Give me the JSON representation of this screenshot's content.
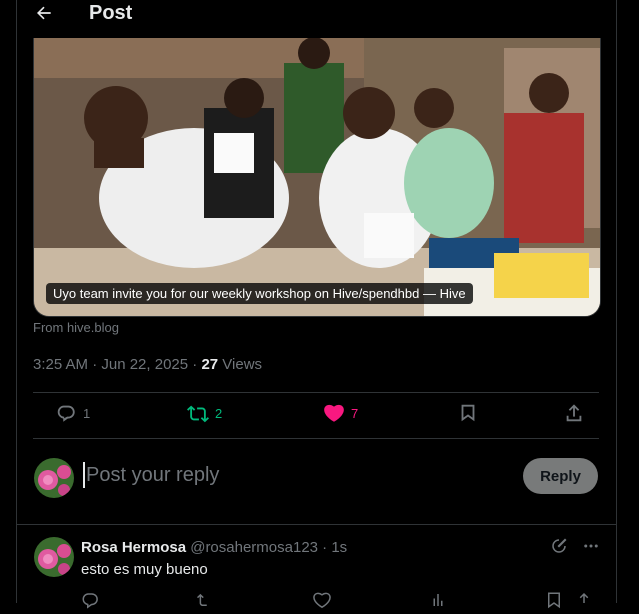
{
  "header": {
    "title": "Post"
  },
  "media": {
    "caption": "Uyo team invite you for our weekly workshop on Hive/spendhbd — Hive",
    "source": "From hive.blog"
  },
  "meta": {
    "time": "3:25 AM · Jun 22, 2025 · ",
    "views_count": "27",
    "views_label": " Views"
  },
  "actions": {
    "replies": "1",
    "reposts": "2",
    "likes": "7"
  },
  "reply": {
    "placeholder": "Post your reply",
    "button_label": "Reply"
  },
  "comment": {
    "name": "Rosa Hermosa",
    "handle": " @rosahermosa123 · 1s",
    "text": "esto es muy bueno"
  },
  "colors": {
    "accent_repost": "#00ba7c",
    "accent_like": "#f91880",
    "muted": "#71767b"
  }
}
